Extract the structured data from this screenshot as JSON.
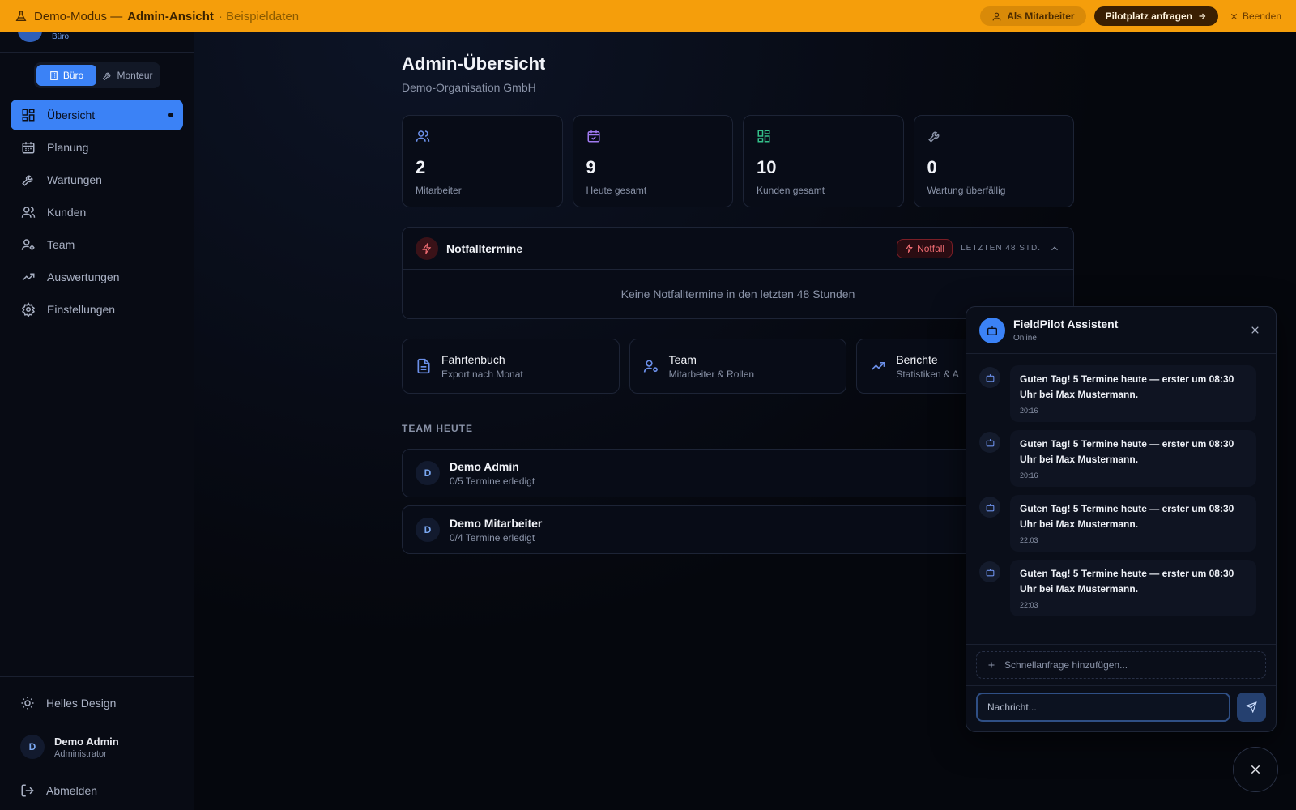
{
  "banner": {
    "mode": "Demo-Modus —",
    "view": "Admin-Ansicht",
    "sample": "· Beispieldaten",
    "as_employee": "Als Mitarbeiter",
    "pilot": "Pilotplatz anfragen",
    "end": "Beenden",
    "color": "#f59e0b"
  },
  "sidebar": {
    "org_sub": "Büro",
    "mode_office": "Büro",
    "mode_fitter": "Monteur",
    "items": [
      {
        "label": "Übersicht",
        "icon": "grid-icon",
        "active": true
      },
      {
        "label": "Planung",
        "icon": "calendar-icon"
      },
      {
        "label": "Wartungen",
        "icon": "wrench-icon"
      },
      {
        "label": "Kunden",
        "icon": "users-icon"
      },
      {
        "label": "Team",
        "icon": "user-gear-icon"
      },
      {
        "label": "Auswertungen",
        "icon": "trend-icon"
      },
      {
        "label": "Einstellungen",
        "icon": "gear-icon"
      }
    ],
    "theme": "Helles Design",
    "user": {
      "initial": "D",
      "name": "Demo Admin",
      "role": "Administrator"
    },
    "logout": "Abmelden",
    "accent": "#3b82f6"
  },
  "main": {
    "title": "Admin-Übersicht",
    "org": "Demo-Organisation GmbH",
    "stats": [
      {
        "value": "2",
        "label": "Mitarbeiter",
        "icon": "users-icon",
        "color": "#6b8fe8"
      },
      {
        "value": "9",
        "label": "Heute gesamt",
        "icon": "calendar-check-icon",
        "color": "#a07af0"
      },
      {
        "value": "10",
        "label": "Kunden gesamt",
        "icon": "grid-icon",
        "color": "#34c08a"
      },
      {
        "value": "0",
        "label": "Wartung überfällig",
        "icon": "wrench-icon",
        "color": "#8a93a8"
      }
    ],
    "emergency": {
      "title": "Notfalltermine",
      "badge": "Notfall",
      "range": "LETZTEN 48 STD.",
      "empty": "Keine Notfalltermine in den letzten 48 Stunden"
    },
    "quick_links": [
      {
        "title": "Fahrtenbuch",
        "sub": "Export nach Monat",
        "icon": "document-icon"
      },
      {
        "title": "Team",
        "sub": "Mitarbeiter & Rollen",
        "icon": "user-gear-icon"
      },
      {
        "title": "Berichte",
        "sub": "Statistiken & A",
        "icon": "trend-icon"
      }
    ],
    "team_title": "TEAM HEUTE",
    "team": [
      {
        "initial": "D",
        "name": "Demo Admin",
        "status": "0/5 Termine erledigt"
      },
      {
        "initial": "D",
        "name": "Demo Mitarbeiter",
        "status": "0/4 Termine erledigt"
      }
    ]
  },
  "chat": {
    "title": "FieldPilot Assistent",
    "status": "Online",
    "messages": [
      {
        "text": "Guten Tag! 5 Termine heute — erster um 08:30 Uhr bei Max Mustermann.",
        "time": "20:16"
      },
      {
        "text": "Guten Tag! 5 Termine heute — erster um 08:30 Uhr bei Max Mustermann.",
        "time": "20:16"
      },
      {
        "text": "Guten Tag! 5 Termine heute — erster um 08:30 Uhr bei Max Mustermann.",
        "time": "22:03"
      },
      {
        "text": "Guten Tag! 5 Termine heute — erster um 08:30 Uhr bei Max Mustermann.",
        "time": "22:03"
      }
    ],
    "quick_add": "Schnellanfrage hinzufügen...",
    "input_placeholder": "Nachricht..."
  }
}
